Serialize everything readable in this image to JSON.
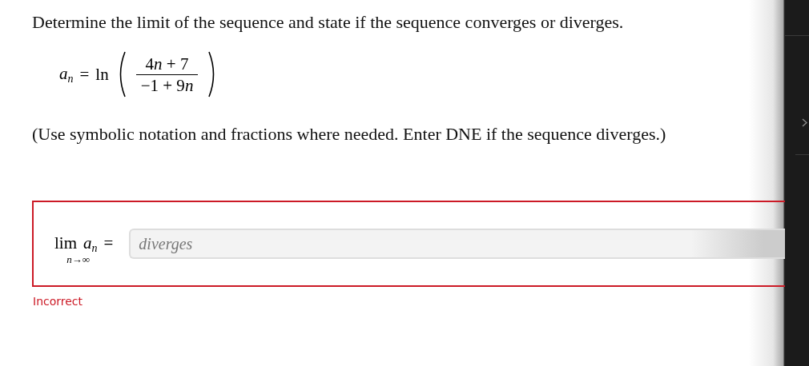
{
  "question": {
    "prompt": "Determine the limit of the sequence and state if the sequence converges or diverges.",
    "formula": {
      "symbol": "a",
      "index": "n",
      "equals": "=",
      "function": "ln",
      "numerator": "4n + 7",
      "denominator": "−1 + 9n"
    },
    "instructions": "(Use symbolic notation and fractions where needed. Enter DNE if the sequence diverges.)"
  },
  "answer": {
    "lim_word": "lim",
    "limit_under": "n→∞",
    "symbol": "a",
    "index": "n",
    "equals": "=",
    "value": "diverges",
    "disabled": true,
    "correct": false,
    "feedback": "Incorrect"
  }
}
